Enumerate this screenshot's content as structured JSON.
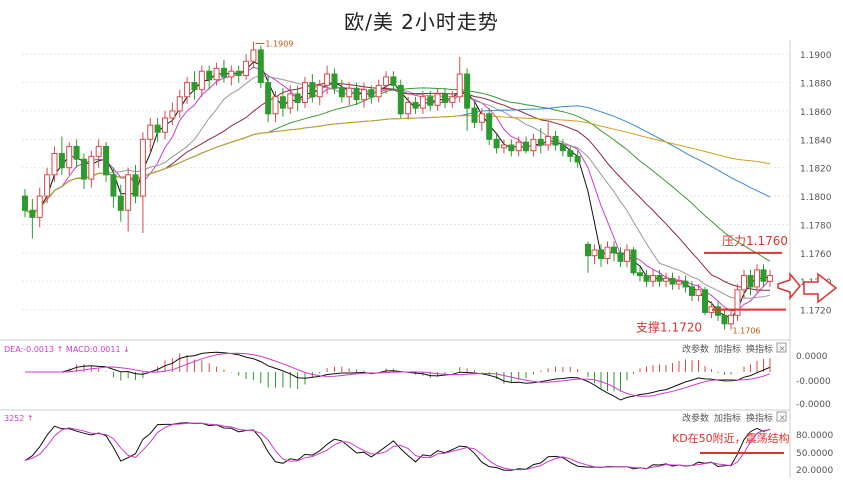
{
  "title": "欧/美 2小时走势",
  "colors": {
    "up": "#d94a4a",
    "down": "#2e9a2e",
    "ma_black": "#111111",
    "ma_magenta": "#d03ad0",
    "ma_gray": "#999999",
    "ma_darkred": "#8a2a3a",
    "ma_green": "#3a9a3a",
    "ma_blue": "#3a8ad0",
    "ma_gold": "#d0a020",
    "annotation_red": "#e03030",
    "grid": "#e6e6e6",
    "axis_text": "#555555"
  },
  "chart_data": [
    {
      "type": "candlestick",
      "name": "price",
      "y_ticks": [
        "1.1900",
        "1.1880",
        "1.1860",
        "1.1840",
        "1.1820",
        "1.1800",
        "1.1780",
        "1.1760",
        "1.1740",
        "1.1720"
      ],
      "ylim": [
        1.17,
        1.191
      ],
      "max_label": "1.1909",
      "min_label": "1.1706",
      "candles": [
        [
          1.18,
          1.179,
          1.1805,
          1.1785
        ],
        [
          1.179,
          1.1785,
          1.1798,
          1.177
        ],
        [
          1.1785,
          1.18,
          1.1806,
          1.1778
        ],
        [
          1.18,
          1.1815,
          1.182,
          1.1795
        ],
        [
          1.1815,
          1.183,
          1.1835,
          1.181
        ],
        [
          1.183,
          1.182,
          1.1842,
          1.1815
        ],
        [
          1.182,
          1.1835,
          1.1838,
          1.1815
        ],
        [
          1.1835,
          1.1826,
          1.184,
          1.182
        ],
        [
          1.1826,
          1.1812,
          1.183,
          1.1805
        ],
        [
          1.1812,
          1.1828,
          1.1832,
          1.1806
        ],
        [
          1.1828,
          1.1835,
          1.184,
          1.182
        ],
        [
          1.1835,
          1.1815,
          1.1838,
          1.181
        ],
        [
          1.1815,
          1.18,
          1.182,
          1.1792
        ],
        [
          1.18,
          1.179,
          1.1808,
          1.1782
        ],
        [
          1.179,
          1.1815,
          1.182,
          1.1775
        ],
        [
          1.1815,
          1.18,
          1.1822,
          1.1795
        ],
        [
          1.18,
          1.184,
          1.1845,
          1.1774
        ],
        [
          1.184,
          1.185,
          1.1855,
          1.183
        ],
        [
          1.185,
          1.1845,
          1.1855,
          1.1838
        ],
        [
          1.1845,
          1.1855,
          1.186,
          1.184
        ],
        [
          1.1855,
          1.186,
          1.1866,
          1.185
        ],
        [
          1.186,
          1.187,
          1.1875,
          1.1855
        ],
        [
          1.187,
          1.188,
          1.1884,
          1.1865
        ],
        [
          1.188,
          1.1875,
          1.1888,
          1.1868
        ],
        [
          1.1875,
          1.1888,
          1.1892,
          1.187
        ],
        [
          1.1888,
          1.1882,
          1.1892,
          1.1875
        ],
        [
          1.1882,
          1.189,
          1.1894,
          1.1878
        ],
        [
          1.189,
          1.1884,
          1.1896,
          1.188
        ],
        [
          1.1884,
          1.1888,
          1.1892,
          1.1878
        ],
        [
          1.1888,
          1.1885,
          1.1892,
          1.188
        ],
        [
          1.1885,
          1.1895,
          1.19,
          1.1882
        ],
        [
          1.1895,
          1.1903,
          1.1909,
          1.189
        ],
        [
          1.1903,
          1.188,
          1.1906,
          1.1876
        ],
        [
          1.188,
          1.1858,
          1.1884,
          1.1852
        ],
        [
          1.1858,
          1.187,
          1.1874,
          1.1852
        ],
        [
          1.187,
          1.1862,
          1.1876,
          1.1856
        ],
        [
          1.1862,
          1.1872,
          1.1878,
          1.1858
        ],
        [
          1.1872,
          1.1866,
          1.1878,
          1.186
        ],
        [
          1.1866,
          1.188,
          1.1884,
          1.1862
        ],
        [
          1.188,
          1.187,
          1.1886,
          1.1866
        ],
        [
          1.187,
          1.1878,
          1.1882,
          1.1864
        ],
        [
          1.1878,
          1.1886,
          1.1892,
          1.1872
        ],
        [
          1.1886,
          1.1876,
          1.189,
          1.1872
        ],
        [
          1.1876,
          1.187,
          1.1882,
          1.1866
        ],
        [
          1.187,
          1.1876,
          1.188,
          1.1864
        ],
        [
          1.1876,
          1.1868,
          1.188,
          1.1864
        ],
        [
          1.1868,
          1.1875,
          1.188,
          1.1862
        ],
        [
          1.1875,
          1.187,
          1.1878,
          1.1865
        ],
        [
          1.187,
          1.1878,
          1.1882,
          1.1866
        ],
        [
          1.1878,
          1.1884,
          1.1888,
          1.1872
        ],
        [
          1.1884,
          1.1878,
          1.1888,
          1.1874
        ],
        [
          1.1878,
          1.1858,
          1.1882,
          1.1855
        ],
        [
          1.1858,
          1.1866,
          1.187,
          1.1854
        ],
        [
          1.1866,
          1.1862,
          1.187,
          1.1858
        ],
        [
          1.1862,
          1.187,
          1.1874,
          1.1858
        ],
        [
          1.187,
          1.1864,
          1.1874,
          1.186
        ],
        [
          1.1864,
          1.1872,
          1.1876,
          1.186
        ],
        [
          1.1872,
          1.1866,
          1.1876,
          1.1862
        ],
        [
          1.1866,
          1.187,
          1.1874,
          1.1862
        ],
        [
          1.187,
          1.1886,
          1.1898,
          1.1866
        ],
        [
          1.1886,
          1.1862,
          1.189,
          1.1846
        ],
        [
          1.1862,
          1.1852,
          1.1866,
          1.1848
        ],
        [
          1.1852,
          1.1858,
          1.1862,
          1.1846
        ],
        [
          1.1858,
          1.184,
          1.1862,
          1.1836
        ],
        [
          1.184,
          1.1834,
          1.1844,
          1.183
        ],
        [
          1.1834,
          1.1836,
          1.184,
          1.183
        ],
        [
          1.1836,
          1.1832,
          1.184,
          1.1828
        ],
        [
          1.1832,
          1.1838,
          1.1842,
          1.1828
        ],
        [
          1.1838,
          1.1832,
          1.1842,
          1.183
        ],
        [
          1.1832,
          1.184,
          1.1844,
          1.1828
        ],
        [
          1.184,
          1.1836,
          1.1848,
          1.183
        ],
        [
          1.1836,
          1.1842,
          1.1852,
          1.1832
        ],
        [
          1.1842,
          1.1836,
          1.1846,
          1.1832
        ],
        [
          1.1836,
          1.1832,
          1.184,
          1.1828
        ],
        [
          1.1832,
          1.1828,
          1.1836,
          1.1824
        ],
        [
          1.1828,
          1.1824,
          1.1832,
          1.182
        ],
        [
          1.1766,
          1.1758,
          1.1768,
          1.1746
        ],
        [
          1.1758,
          1.1762,
          1.1766,
          1.1752
        ],
        [
          1.1762,
          1.1756,
          1.1766,
          1.175
        ],
        [
          1.1756,
          1.1764,
          1.1768,
          1.1752
        ],
        [
          1.1764,
          1.176,
          1.1768,
          1.1754
        ],
        [
          1.176,
          1.1754,
          1.1764,
          1.175
        ],
        [
          1.1754,
          1.1762,
          1.1766,
          1.175
        ],
        [
          1.1762,
          1.1746,
          1.1764,
          1.1744
        ],
        [
          1.1746,
          1.1744,
          1.175,
          1.174
        ],
        [
          1.1744,
          1.174,
          1.1748,
          1.1736
        ],
        [
          1.174,
          1.1744,
          1.1748,
          1.1736
        ],
        [
          1.1744,
          1.174,
          1.1748,
          1.1736
        ],
        [
          1.174,
          1.1742,
          1.1746,
          1.1736
        ],
        [
          1.1742,
          1.1738,
          1.1746,
          1.1734
        ],
        [
          1.1738,
          1.174,
          1.1744,
          1.1734
        ],
        [
          1.174,
          1.1736,
          1.1744,
          1.1732
        ],
        [
          1.1736,
          1.173,
          1.174,
          1.1726
        ],
        [
          1.173,
          1.1734,
          1.1738,
          1.1726
        ],
        [
          1.1734,
          1.1718,
          1.1736,
          1.1716
        ],
        [
          1.1718,
          1.1722,
          1.1726,
          1.1714
        ],
        [
          1.1722,
          1.1716,
          1.1726,
          1.1712
        ],
        [
          1.1716,
          1.171,
          1.172,
          1.1706
        ],
        [
          1.171,
          1.1716,
          1.172,
          1.1706
        ],
        [
          1.1716,
          1.1734,
          1.1738,
          1.1712
        ],
        [
          1.1734,
          1.1744,
          1.1748,
          1.1728
        ],
        [
          1.1744,
          1.1736,
          1.1748,
          1.173
        ],
        [
          1.1736,
          1.1748,
          1.1752,
          1.1732
        ],
        [
          1.1748,
          1.174,
          1.1752,
          1.1736
        ],
        [
          1.174,
          1.1744,
          1.1748,
          1.1736
        ]
      ]
    },
    {
      "type": "line",
      "name": "macd",
      "legend": "DEA:-0.0013 ↑ MACD:0.0011 ↓",
      "y_ticks": [
        "0.0000",
        "-0.0000",
        "-0.0000"
      ],
      "toolbar": [
        "改参数",
        "加指标",
        "换指标"
      ]
    },
    {
      "type": "line",
      "name": "kd",
      "legend": "3252 ↑",
      "y_ticks": [
        "80.0000",
        "50.0000",
        "20.0000"
      ],
      "toolbar": [
        "改参数",
        "加指标",
        "换指标"
      ]
    }
  ],
  "annotations": {
    "resistance": "压力1.1760",
    "support": "支撑1.1720",
    "kd_note": "KD在50附近，震荡结构"
  }
}
